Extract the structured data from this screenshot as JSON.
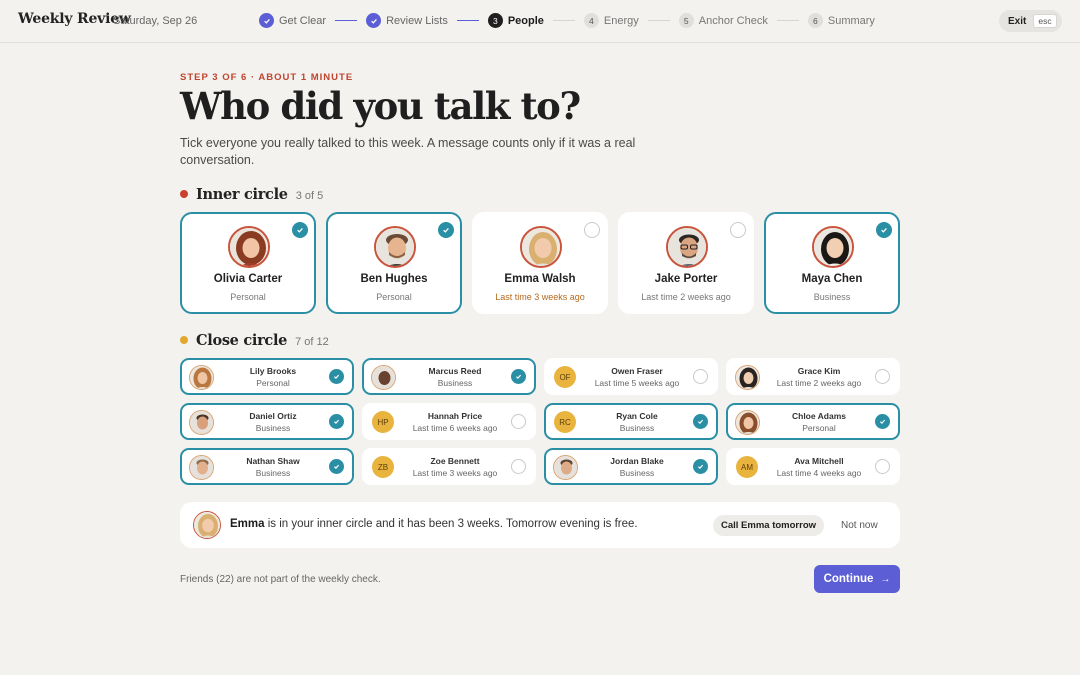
{
  "header": {
    "brand": "Weekly Review",
    "date": "Saturday, Sep 26",
    "steps": [
      {
        "num": "1",
        "label": "Get Clear",
        "state": "done"
      },
      {
        "num": "2",
        "label": "Review Lists",
        "state": "done"
      },
      {
        "num": "3",
        "label": "People",
        "state": "active"
      },
      {
        "num": "4",
        "label": "Energy",
        "state": "todo"
      },
      {
        "num": "5",
        "label": "Anchor Check",
        "state": "todo"
      },
      {
        "num": "6",
        "label": "Summary",
        "state": "todo"
      }
    ],
    "exit_label": "Exit",
    "exit_key": "esc"
  },
  "main": {
    "kicker": "STEP 3 OF 6 · ABOUT 1 MINUTE",
    "title": "Who did you talk to?",
    "description": "Tick everyone you really talked to this week. A message counts only if it was a real conversation."
  },
  "inner": {
    "name": "Inner circle",
    "count": "3 of 5",
    "color": "#c9412d",
    "people": [
      {
        "name": "Olivia Carter",
        "sub": "Personal",
        "selected": true,
        "warn": false
      },
      {
        "name": "Ben Hughes",
        "sub": "Personal",
        "selected": true,
        "warn": false
      },
      {
        "name": "Emma Walsh",
        "sub": "Last time 3 weeks ago",
        "selected": false,
        "warn": true
      },
      {
        "name": "Jake Porter",
        "sub": "Last time 2 weeks ago",
        "selected": false,
        "warn": false
      },
      {
        "name": "Maya Chen",
        "sub": "Business",
        "selected": true,
        "warn": false
      }
    ]
  },
  "close": {
    "name": "Close circle",
    "count": "7 of 12",
    "color": "#e2a82e",
    "people": [
      {
        "name": "Lily Brooks",
        "sub": "Personal",
        "selected": true,
        "initials": ""
      },
      {
        "name": "Marcus Reed",
        "sub": "Business",
        "selected": true,
        "initials": ""
      },
      {
        "name": "Owen Fraser",
        "sub": "Last time 5 weeks ago",
        "selected": false,
        "initials": "OF"
      },
      {
        "name": "Grace Kim",
        "sub": "Last time 2 weeks ago",
        "selected": false,
        "initials": ""
      },
      {
        "name": "Daniel Ortiz",
        "sub": "Business",
        "selected": true,
        "initials": ""
      },
      {
        "name": "Hannah Price",
        "sub": "Last time 6 weeks ago",
        "selected": false,
        "initials": "HP"
      },
      {
        "name": "Ryan Cole",
        "sub": "Business",
        "selected": true,
        "initials": "RC"
      },
      {
        "name": "Chloe Adams",
        "sub": "Personal",
        "selected": true,
        "initials": ""
      },
      {
        "name": "Nathan Shaw",
        "sub": "Business",
        "selected": true,
        "initials": ""
      },
      {
        "name": "Zoe Bennett",
        "sub": "Last time 3 weeks ago",
        "selected": false,
        "initials": "ZB"
      },
      {
        "name": "Jordan Blake",
        "sub": "Business",
        "selected": true,
        "initials": ""
      },
      {
        "name": "Ava Mitchell",
        "sub": "Last time 4 weeks ago",
        "selected": false,
        "initials": "AM"
      }
    ]
  },
  "suggestion": {
    "person": "Emma",
    "text": " is in your inner circle and it has been 3 weeks. Tomorrow evening is free.",
    "call_label": "Call Emma tomorrow",
    "dismiss_label": "Not now"
  },
  "footer": {
    "note": "Friends (22) are not part of the weekly check.",
    "continue_label": "Continue"
  },
  "colors": {
    "accent": "#5b5ed4",
    "selected_border": "#2a8fa5",
    "kicker": "#c0442f",
    "warn": "#b66a1c"
  }
}
